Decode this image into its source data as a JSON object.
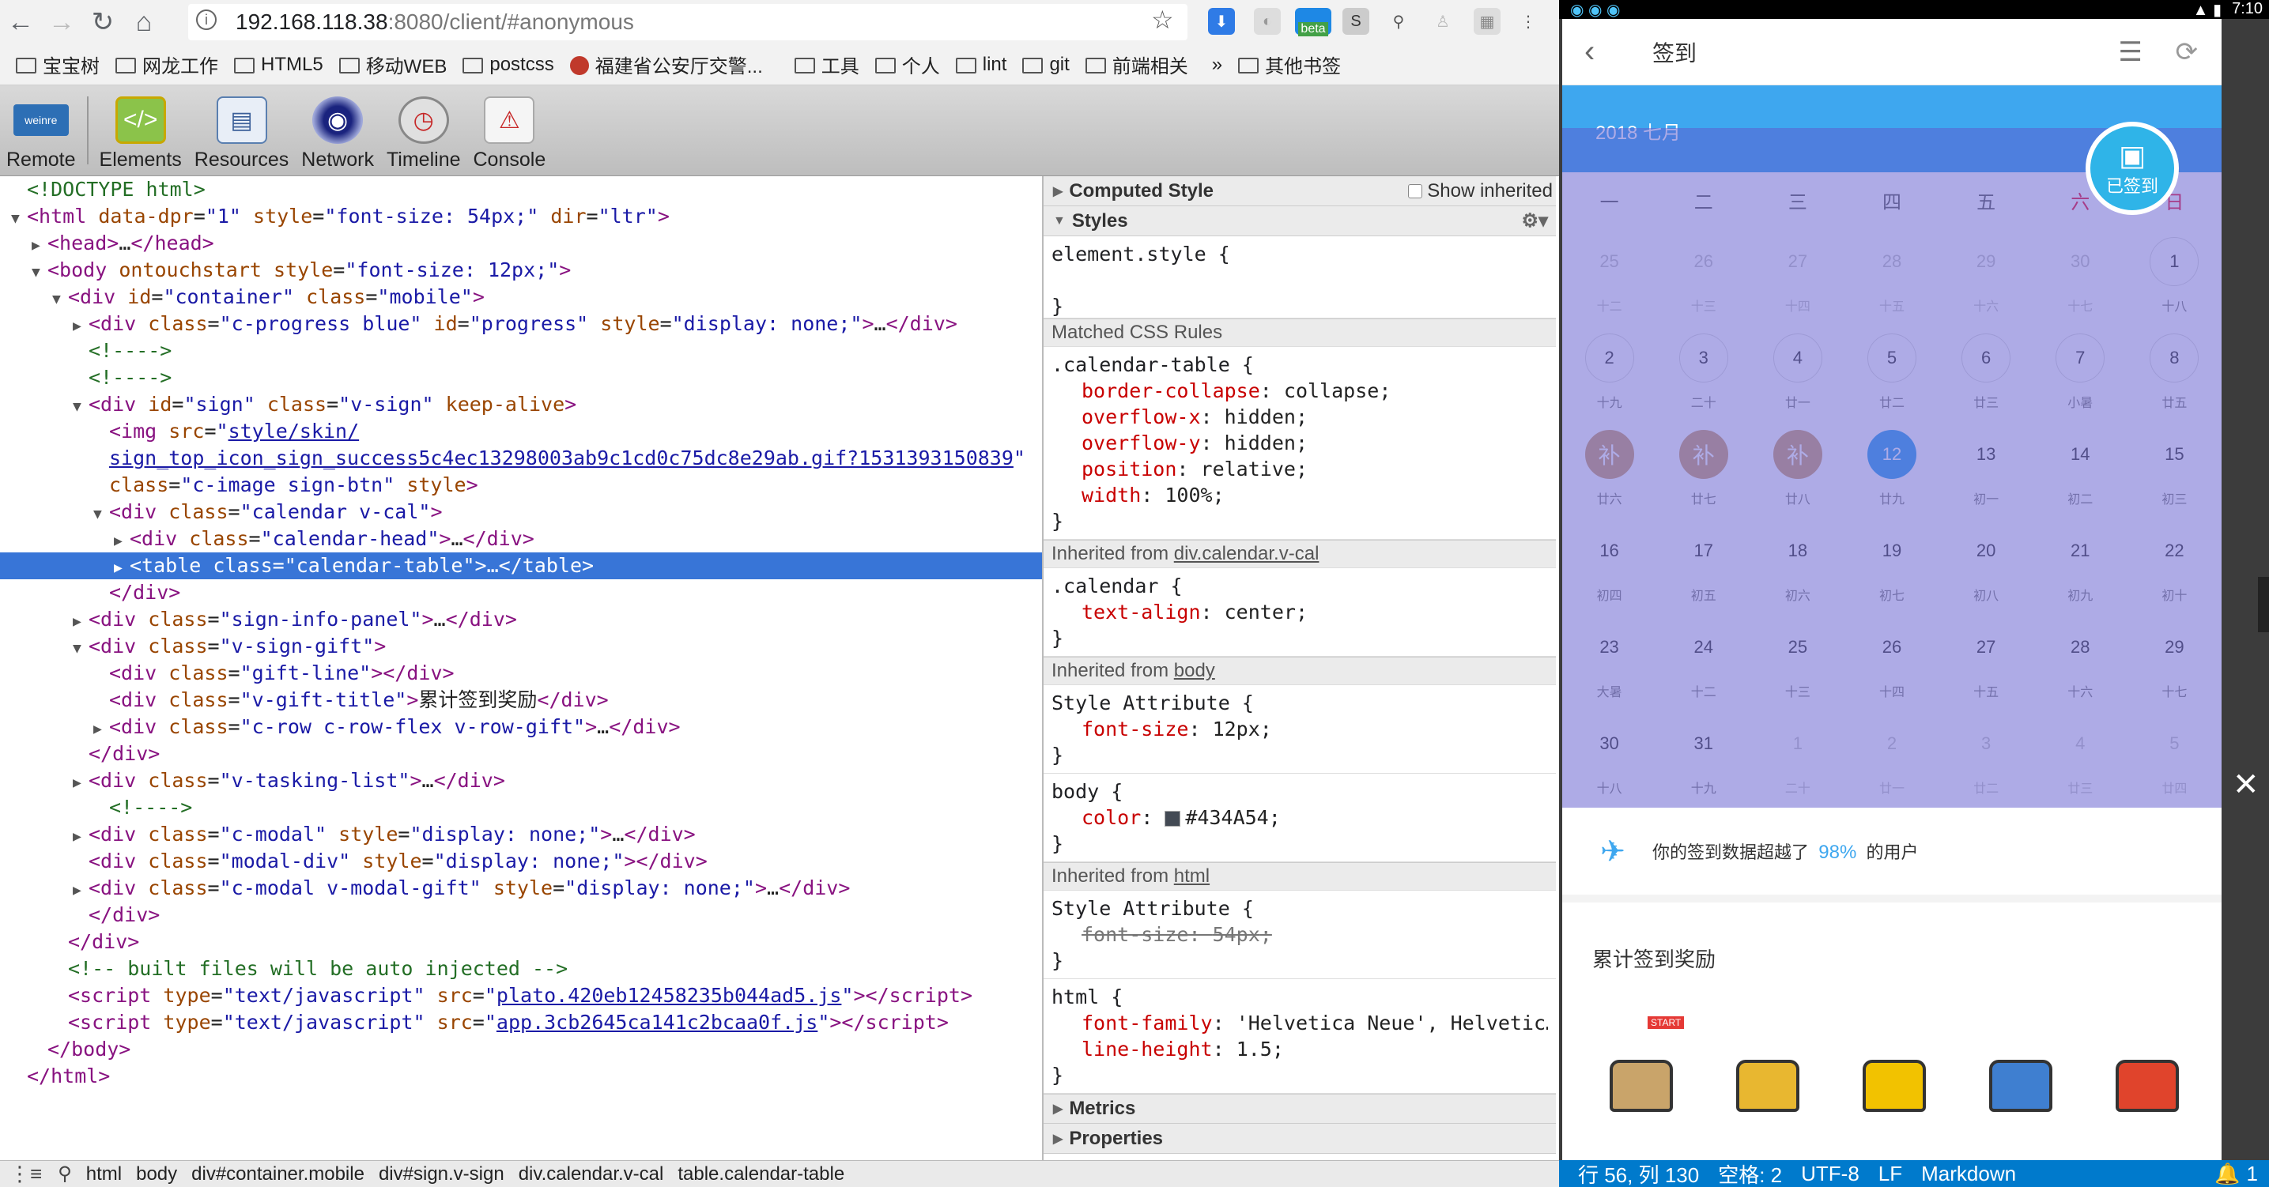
{
  "browser": {
    "url_host": "192.168.118.38",
    "url_path": ":8080/client/#anonymous",
    "ext_badge": "beta",
    "bookmarks": [
      "宝宝树",
      "网龙工作",
      "HTML5",
      "移动WEB",
      "postcss",
      "福建省公安厅交警...",
      "工具",
      "个人",
      "lint",
      "git",
      "前端相关"
    ],
    "bookmarks_more": "»",
    "other_bookmarks": "其他书签"
  },
  "devtools": {
    "tools": [
      "Remote",
      "Elements",
      "Resources",
      "Network",
      "Timeline",
      "Console"
    ],
    "remote_logo": "weinre",
    "dom": [
      {
        "i": 0,
        "t": "",
        "h": "<span class='cm'>&lt;!DOCTYPE html&gt;</span>"
      },
      {
        "i": 0,
        "t": "▼",
        "h": "<span class='tag'>&lt;html</span> <span class='attr'>data-dpr</span>=<span class='val'>\"1\"</span> <span class='attr'>style</span>=<span class='val'>\"font-size: 54px;\"</span> <span class='attr'>dir</span>=<span class='val'>\"ltr\"</span><span class='tag'>&gt;</span>"
      },
      {
        "i": 1,
        "t": "▶",
        "h": "<span class='tag'>&lt;head&gt;</span>…<span class='tag'>&lt;/head&gt;</span>"
      },
      {
        "i": 1,
        "t": "▼",
        "h": "<span class='tag'>&lt;body</span> <span class='attr'>ontouchstart</span> <span class='attr'>style</span>=<span class='val'>\"font-size: 12px;\"</span><span class='tag'>&gt;</span>"
      },
      {
        "i": 2,
        "t": "▼",
        "h": "<span class='tag'>&lt;div</span> <span class='attr'>id</span>=<span class='val'>\"container\"</span> <span class='attr'>class</span>=<span class='val'>\"mobile\"</span><span class='tag'>&gt;</span>"
      },
      {
        "i": 3,
        "t": "▶",
        "h": "<span class='tag'>&lt;div</span> <span class='attr'>class</span>=<span class='val'>\"c-progress blue\"</span> <span class='attr'>id</span>=<span class='val'>\"progress\"</span> <span class='attr'>style</span>=<span class='val'>\"display: none;\"</span><span class='tag'>&gt;</span>…<span class='tag'>&lt;/div&gt;</span>"
      },
      {
        "i": 3,
        "t": "",
        "h": "<span class='cm'>&lt;!----&gt;</span>"
      },
      {
        "i": 3,
        "t": "",
        "h": "<span class='cm'>&lt;!----&gt;</span>"
      },
      {
        "i": 3,
        "t": "▼",
        "h": "<span class='tag'>&lt;div</span> <span class='attr'>id</span>=<span class='val'>\"sign\"</span> <span class='attr'>class</span>=<span class='val'>\"v-sign\"</span> <span class='attr'>keep-alive</span><span class='tag'>&gt;</span>"
      },
      {
        "i": 4,
        "t": "",
        "h": "<span class='tag'>&lt;img</span> <span class='attr'>src</span>=<span class='val'>\"</span><span class='lnk'>style/skin/</span>"
      },
      {
        "i": 4,
        "t": "",
        "h": "<span class='lnk'>sign_top_icon_sign_success5c4ec13298003ab9c1cd0c75dc8e29ab.gif?1531393150839</span><span class='val'>\"</span>"
      },
      {
        "i": 4,
        "t": "",
        "h": "<span class='attr'>class</span>=<span class='val'>\"c-image sign-btn\"</span> <span class='attr'>style</span><span class='tag'>&gt;</span>"
      },
      {
        "i": 4,
        "t": "▼",
        "h": "<span class='tag'>&lt;div</span> <span class='attr'>class</span>=<span class='val'>\"calendar v-cal\"</span><span class='tag'>&gt;</span>"
      },
      {
        "i": 5,
        "t": "▶",
        "h": "<span class='tag'>&lt;div</span> <span class='attr'>class</span>=<span class='val'>\"calendar-head\"</span><span class='tag'>&gt;</span>…<span class='tag'>&lt;/div&gt;</span>"
      },
      {
        "i": 5,
        "t": "▶",
        "h": "<span class='tag'>&lt;table</span> <span class='attr'>class</span>=<span class='val'>\"calendar-table\"</span><span class='tag'>&gt;</span>…<span class='tag'>&lt;/table&gt;</span>",
        "sel": true
      },
      {
        "i": 4,
        "t": "",
        "h": "<span class='tag'>&lt;/div&gt;</span>"
      },
      {
        "i": 3,
        "t": "▶",
        "h": "<span class='tag'>&lt;div</span> <span class='attr'>class</span>=<span class='val'>\"sign-info-panel\"</span><span class='tag'>&gt;</span>…<span class='tag'>&lt;/div&gt;</span>"
      },
      {
        "i": 3,
        "t": "▼",
        "h": "<span class='tag'>&lt;div</span> <span class='attr'>class</span>=<span class='val'>\"v-sign-gift\"</span><span class='tag'>&gt;</span>"
      },
      {
        "i": 4,
        "t": "",
        "h": "<span class='tag'>&lt;div</span> <span class='attr'>class</span>=<span class='val'>\"gift-line\"</span><span class='tag'>&gt;&lt;/div&gt;</span>"
      },
      {
        "i": 4,
        "t": "",
        "h": "<span class='tag'>&lt;div</span> <span class='attr'>class</span>=<span class='val'>\"v-gift-title\"</span><span class='tag'>&gt;</span>累计签到奖励<span class='tag'>&lt;/div&gt;</span>"
      },
      {
        "i": 4,
        "t": "▶",
        "h": "<span class='tag'>&lt;div</span> <span class='attr'>class</span>=<span class='val'>\"c-row c-row-flex v-row-gift\"</span><span class='tag'>&gt;</span>…<span class='tag'>&lt;/div&gt;</span>"
      },
      {
        "i": 3,
        "t": "",
        "h": "<span class='tag'>&lt;/div&gt;</span>"
      },
      {
        "i": 3,
        "t": "▶",
        "h": "<span class='tag'>&lt;div</span> <span class='attr'>class</span>=<span class='val'>\"v-tasking-list\"</span><span class='tag'>&gt;</span>…<span class='tag'>&lt;/div&gt;</span>"
      },
      {
        "i": 4,
        "t": "",
        "h": "<span class='cm'>&lt;!----&gt;</span>"
      },
      {
        "i": 3,
        "t": "▶",
        "h": "<span class='tag'>&lt;div</span> <span class='attr'>class</span>=<span class='val'>\"c-modal\"</span> <span class='attr'>style</span>=<span class='val'>\"display: none;\"</span><span class='tag'>&gt;</span>…<span class='tag'>&lt;/div&gt;</span>"
      },
      {
        "i": 3,
        "t": "",
        "h": "<span class='tag'>&lt;div</span> <span class='attr'>class</span>=<span class='val'>\"modal-div\"</span> <span class='attr'>style</span>=<span class='val'>\"display: none;\"</span><span class='tag'>&gt;&lt;/div&gt;</span>"
      },
      {
        "i": 3,
        "t": "▶",
        "h": "<span class='tag'>&lt;div</span> <span class='attr'>class</span>=<span class='val'>\"c-modal v-modal-gift\"</span> <span class='attr'>style</span>=<span class='val'>\"display: none;\"</span><span class='tag'>&gt;</span>…<span class='tag'>&lt;/div&gt;</span>"
      },
      {
        "i": 3,
        "t": "",
        "h": "<span class='tag'>&lt;/div&gt;</span>"
      },
      {
        "i": 2,
        "t": "",
        "h": "<span class='tag'>&lt;/div&gt;</span>"
      },
      {
        "i": 2,
        "t": "",
        "h": "<span class='cm'>&lt;!-- built files will be auto injected --&gt;</span>"
      },
      {
        "i": 2,
        "t": "",
        "h": "<span class='tag'>&lt;script</span> <span class='attr'>type</span>=<span class='val'>\"text/javascript\"</span> <span class='attr'>src</span>=<span class='val'>\"</span><span class='lnk'>plato.420eb12458235b044ad5.js</span><span class='val'>\"</span><span class='tag'>&gt;&lt;/script&gt;</span>"
      },
      {
        "i": 2,
        "t": "",
        "h": "<span class='tag'>&lt;script</span> <span class='attr'>type</span>=<span class='val'>\"text/javascript\"</span> <span class='attr'>src</span>=<span class='val'>\"</span><span class='lnk'>app.3cb2645ca141c2bcaa0f.js</span><span class='val'>\"</span><span class='tag'>&gt;&lt;/script&gt;</span>"
      },
      {
        "i": 1,
        "t": "",
        "h": "<span class='tag'>&lt;/body&gt;</span>"
      },
      {
        "i": 0,
        "t": "",
        "h": "<span class='tag'>&lt;/html&gt;</span>"
      }
    ],
    "styles": {
      "computed_style": "Computed Style",
      "show_inherited": "Show inherited",
      "styles_head": "Styles",
      "element_style": "element.style {",
      "close_brace": "}",
      "matched": "Matched CSS Rules",
      "rule1_sel": ".calendar-table {",
      "rule1_props": [
        [
          "border-collapse",
          "collapse"
        ],
        [
          "overflow-x",
          "hidden"
        ],
        [
          "overflow-y",
          "hidden"
        ],
        [
          "position",
          "relative"
        ],
        [
          "width",
          "100%"
        ]
      ],
      "inh1": "Inherited from ",
      "inh1_link": "div.calendar.v-cal",
      "rule2_sel": ".calendar {",
      "rule2_prop": [
        "text-align",
        "center"
      ],
      "inh2": "Inherited from ",
      "inh2_link": "body",
      "style_attr": "Style Attribute {",
      "rule3_prop": [
        "font-size",
        "12px"
      ],
      "body_sel": "body {",
      "body_prop": [
        "color",
        "#434A54"
      ],
      "inh3": "Inherited from ",
      "inh3_link": "html",
      "rule4_prop": [
        "font-size",
        "54px"
      ],
      "html_sel": "html {",
      "html_props": [
        [
          "font-family",
          "'Helvetica Neue', Helvetic…"
        ],
        [
          "line-height",
          "1.5"
        ]
      ],
      "metrics": "Metrics",
      "properties": "Properties"
    },
    "breadcrumbs": [
      "html",
      "body",
      "div#container.mobile",
      "div#sign.v-sign",
      "div.calendar.v-cal",
      "table.calendar-table"
    ]
  },
  "phone": {
    "status_time": "7:10",
    "page_title": "签到",
    "month_label": "2018  七月",
    "signed_label": "已签到",
    "weekdays": [
      "一",
      "二",
      "三",
      "四",
      "五",
      "六",
      "日"
    ],
    "weeks": [
      [
        [
          "25",
          "十二",
          "f"
        ],
        [
          "26",
          "十三",
          "f"
        ],
        [
          "27",
          "十四",
          "f"
        ],
        [
          "28",
          "十五",
          "f"
        ],
        [
          "29",
          "十六",
          "f"
        ],
        [
          "30",
          "十七",
          "f"
        ],
        [
          "1",
          "十八",
          ""
        ]
      ],
      [
        [
          "2",
          "十九",
          ""
        ],
        [
          "3",
          "二十",
          ""
        ],
        [
          "4",
          "廿一",
          ""
        ],
        [
          "5",
          "廿二",
          ""
        ],
        [
          "6",
          "廿三",
          ""
        ],
        [
          "7",
          "小暑",
          ""
        ],
        [
          "8",
          "廿五",
          ""
        ]
      ],
      [
        [
          "补",
          "廿六",
          "bu"
        ],
        [
          "补",
          "廿七",
          "bu"
        ],
        [
          "补",
          "廿八",
          "bu"
        ],
        [
          "12",
          "廿九",
          "today"
        ],
        [
          "13",
          "初一",
          "p"
        ],
        [
          "14",
          "初二",
          "p"
        ],
        [
          "15",
          "初三",
          "p"
        ]
      ],
      [
        [
          "16",
          "初四",
          "p"
        ],
        [
          "17",
          "初五",
          "p"
        ],
        [
          "18",
          "初六",
          "p"
        ],
        [
          "19",
          "初七",
          "p"
        ],
        [
          "20",
          "初八",
          "p"
        ],
        [
          "21",
          "初九",
          "p"
        ],
        [
          "22",
          "初十",
          "p"
        ]
      ],
      [
        [
          "23",
          "大暑",
          "p"
        ],
        [
          "24",
          "十二",
          "p"
        ],
        [
          "25",
          "十三",
          "p"
        ],
        [
          "26",
          "十四",
          "p"
        ],
        [
          "27",
          "十五",
          "p"
        ],
        [
          "28",
          "十六",
          "p"
        ],
        [
          "29",
          "十七",
          "p"
        ]
      ],
      [
        [
          "30",
          "十八",
          "p"
        ],
        [
          "31",
          "十九",
          "p"
        ],
        [
          "1",
          "二十",
          "f"
        ],
        [
          "2",
          "廿一",
          "f"
        ],
        [
          "3",
          "廿二",
          "f"
        ],
        [
          "4",
          "廿三",
          "f"
        ],
        [
          "5",
          "廿四",
          "f"
        ]
      ]
    ],
    "summary_pre": "你的签到数据超越了",
    "summary_pct": "98%",
    "summary_post": "的用户",
    "reward_title": "累计签到奖励",
    "start_tag": "START",
    "chest_colors": [
      "#c9a46a",
      "#e8b730",
      "#f2c200",
      "#3f7fd0",
      "#e0442c"
    ],
    "close_label": "✕"
  },
  "editor_status": [
    "行 56, 列 130",
    "空格: 2",
    "UTF-8",
    "LF",
    "Markdown"
  ],
  "editor_notice": "1"
}
